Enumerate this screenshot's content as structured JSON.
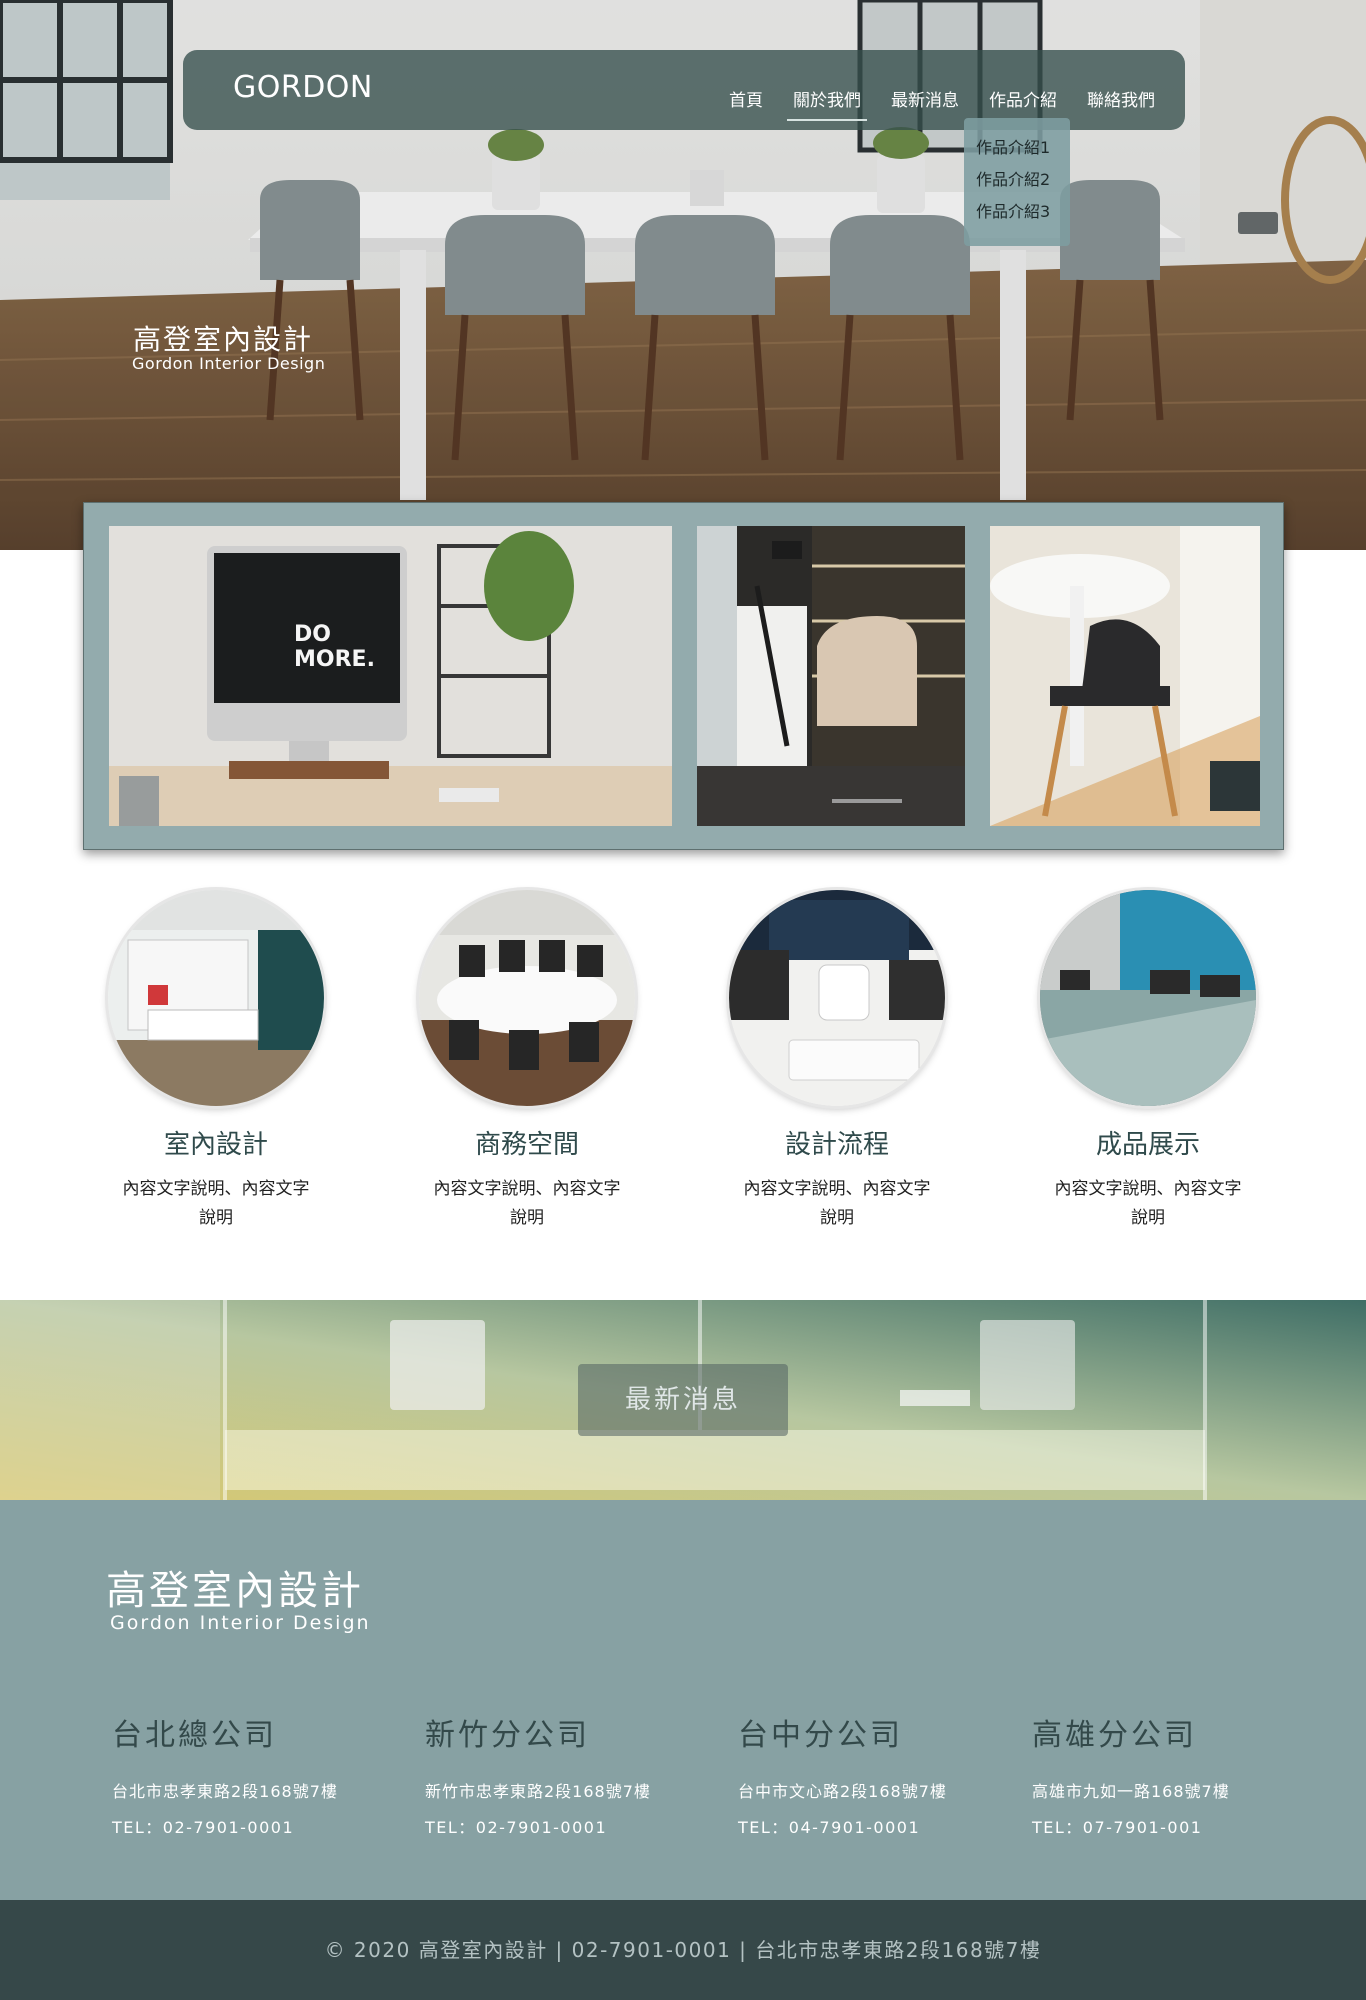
{
  "nav": {
    "logo": "GORDON",
    "items": [
      "首頁",
      "關於我們",
      "最新消息",
      "作品介紹",
      "聯絡我們"
    ],
    "active_item": "關於我們",
    "dropdown": [
      "作品介紹1",
      "作品介紹2",
      "作品介紹3"
    ]
  },
  "hero": {
    "title": "高登室內設計",
    "subtitle": "Gordon  Interior Design"
  },
  "gallery": {
    "monitor_text_line1": "DO",
    "monitor_text_line2": "MORE."
  },
  "services": [
    {
      "title": "室內設計",
      "desc": "內容文字說明、內容文字說明"
    },
    {
      "title": "商務空間",
      "desc": "內容文字說明、內容文字說明"
    },
    {
      "title": "設計流程",
      "desc": "內容文字說明、內容文字說明"
    },
    {
      "title": "成品展示",
      "desc": "內容文字說明、內容文字說明"
    }
  ],
  "news": {
    "button_label": "最新消息"
  },
  "footer": {
    "title": "高登室內設計",
    "subtitle": "Gordon Interior Design",
    "offices": [
      {
        "name": "台北總公司",
        "address": "台北市忠孝東路2段168號7樓",
        "tel": "TEL：02-7901-0001"
      },
      {
        "name": "新竹分公司",
        "address": "新竹市忠孝東路2段168號7樓",
        "tel": "TEL：02-7901-0001"
      },
      {
        "name": "台中分公司",
        "address": "台中市文心路2段168號7樓",
        "tel": "TEL：04-7901-0001"
      },
      {
        "name": "高雄分公司",
        "address": "高雄市九如一路168號7樓",
        "tel": "TEL：07-7901-001"
      }
    ],
    "copyright": "© 2020 高登室內設計 | 02-7901-0001 | 台北市忠孝東路2段168號7樓"
  },
  "colors": {
    "nav_bg": "#344e4c",
    "gallery_frame": "#93abad",
    "footer_bg": "#87a1a3",
    "copyright_bg": "#364849",
    "accent_text": "#2f4a4b"
  }
}
